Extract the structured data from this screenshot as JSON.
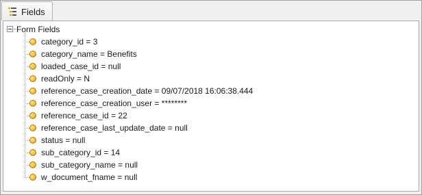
{
  "tab": {
    "label": "Fields",
    "icon": "list-tree-icon"
  },
  "tree": {
    "root_label": "Form Fields",
    "items": [
      "category_id = 3",
      "category_name = Benefits",
      "loaded_case_id = null",
      "readOnly = N",
      "reference_case_creation_date = 09/07/2018 16:06:38.444",
      "reference_case_creation_user = ********",
      "reference_case_id = 22",
      "reference_case_last_update_date = null",
      "status = null",
      "sub_category_id = 14",
      "sub_category_name = null",
      "w_document_fname = null"
    ]
  }
}
